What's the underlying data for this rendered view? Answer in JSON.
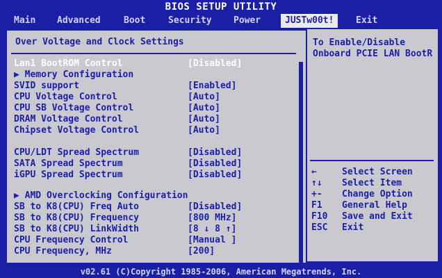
{
  "title": "BIOS SETUP UTILITY",
  "tabs": [
    "Main",
    "Advanced",
    "Boot",
    "Security",
    "Power",
    "JUSTw00t!",
    "Exit"
  ],
  "active_tab": "JUSTw00t!",
  "section_title": "Over Voltage and Clock Settings",
  "settings": [
    {
      "label": "Lan1 BootROM Control",
      "value": "[Disabled]"
    },
    {
      "label": "▶ Memory Configuration",
      "value": ""
    },
    {
      "label": "SVID support",
      "value": "[Enabled]"
    },
    {
      "label": "CPU Voltage Control",
      "value": "[Auto]"
    },
    {
      "label": "CPU SB Voltage Control",
      "value": "[Auto]"
    },
    {
      "label": "DRAM Voltage Control",
      "value": "[Auto]"
    },
    {
      "label": "Chipset Voltage Control",
      "value": "[Auto]"
    },
    {
      "label": "CPU/LDT Spread Spectrum",
      "value": "[Disabled]"
    },
    {
      "label": "SATA Spread Spectrum",
      "value": "[Disabled]"
    },
    {
      "label": "iGPU Spread Spectrum",
      "value": "[Disabled]"
    },
    {
      "label": "▶ AMD Overclocking Configuration",
      "value": ""
    },
    {
      "label": "SB to K8(CPU) Freq Auto",
      "value": "[Disabled]"
    },
    {
      "label": "SB to K8(CPU) Frequency",
      "value": "[800 MHz]"
    },
    {
      "label": "SB to K8(CPU) LinkWidth",
      "value": "[8 ↓ 8 ↑]"
    },
    {
      "label": "CPU Frequency Control",
      "value": "[Manual ]"
    },
    {
      "label": "CPU Frequency, MHz",
      "value": "[200]"
    }
  ],
  "help": {
    "line1": "To Enable/Disable",
    "line2": "Onboard PCIE LAN BootR"
  },
  "keys": [
    {
      "key": "←",
      "desc": "Select Screen"
    },
    {
      "key": "↑↓",
      "desc": "Select Item"
    },
    {
      "key": "+-",
      "desc": "Change Option"
    },
    {
      "key": "F1",
      "desc": "General Help"
    },
    {
      "key": "F10",
      "desc": "Save and Exit"
    },
    {
      "key": "ESC",
      "desc": "Exit"
    }
  ],
  "footer": "v02.61 (C)Copyright 1985-2006, American Megatrends, Inc.",
  "colors": {
    "background": "#1a1fa6",
    "panel": "#c9c9cf",
    "text": "#1a1fa6",
    "highlight": "#ffffff"
  }
}
